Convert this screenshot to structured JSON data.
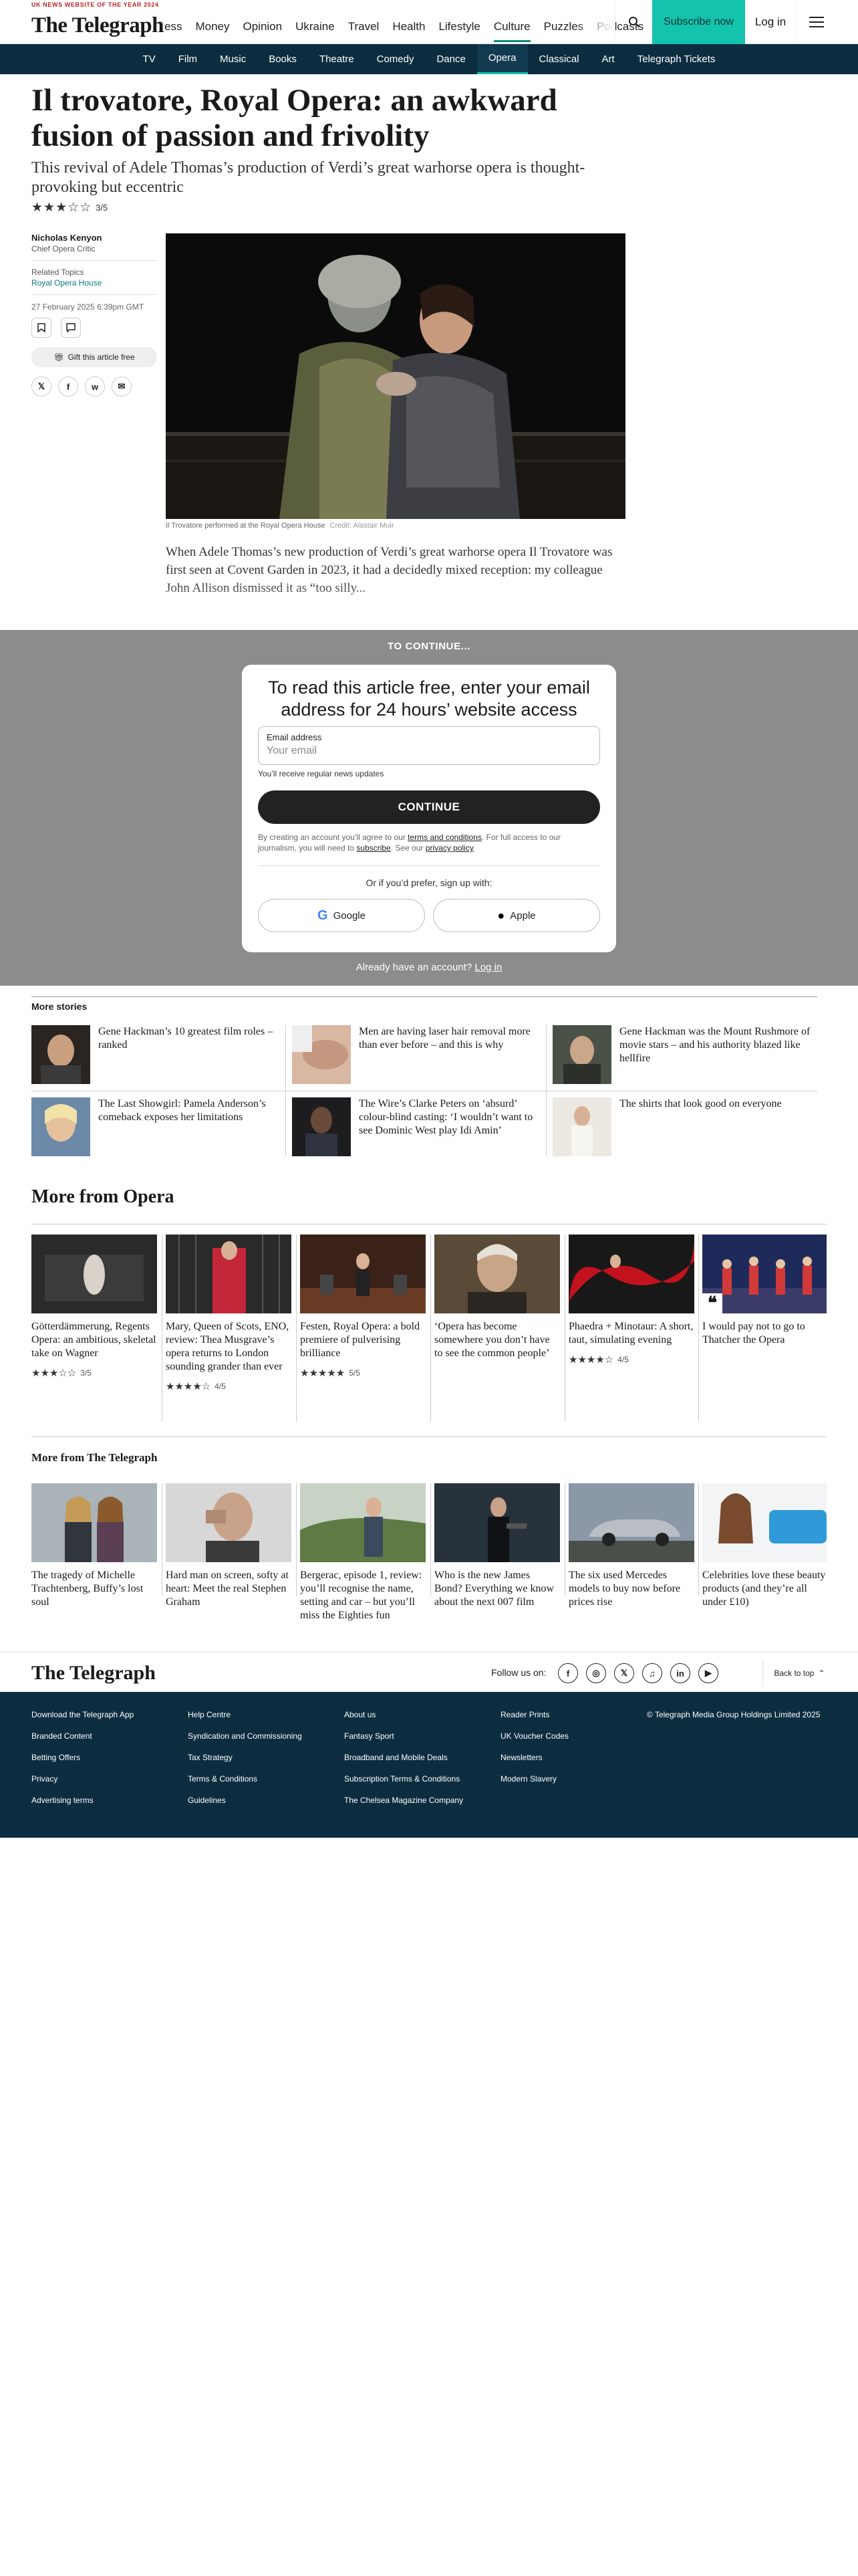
{
  "header": {
    "award": "UK NEWS WEBSITE OF THE YEAR 2024",
    "logo": "The Telegraph",
    "nav": [
      "ess",
      "Money",
      "Opinion",
      "Ukraine",
      "Travel",
      "Health",
      "Lifestyle",
      "Culture",
      "Puzzles",
      "Podcasts"
    ],
    "subscribe": "Subscribe now",
    "login": "Log in"
  },
  "subnav": [
    "TV",
    "Film",
    "Music",
    "Books",
    "Theatre",
    "Comedy",
    "Dance",
    "Opera",
    "Classical",
    "Art",
    "Telegraph Tickets"
  ],
  "article": {
    "headline": "Il trovatore, Royal Opera: an awkward fusion of passion and frivolity",
    "standfirst": "This revival of Adele Thomas’s production of Verdi’s great warhorse opera is thought-provoking but eccentric",
    "stars": "★★★☆☆",
    "rating": "3/5",
    "author": "Nicholas Kenyon",
    "role": "Chief Opera Critic",
    "related_label": "Related Topics",
    "related_topic": "Royal Opera House",
    "date": "27 February 2025 6:39pm GMT",
    "gift": "Gift this article free",
    "share": [
      "𝕏",
      "f",
      "w",
      "✉"
    ],
    "caption": "Il Trovatore performed at the Royal Opera House",
    "credit": "Credit: Alastair Muir",
    "body": "When Adele Thomas’s new production of Verdi’s great warhorse opera Il Trovatore was first seen at Covent Garden in 2023, it had a decidedly mixed reception: my colleague John Allison dismissed it as “too silly..."
  },
  "paywall": {
    "continue_banner": "TO CONTINUE...",
    "title": "To read this article free, enter your email address for 24 hours’ website access",
    "email_label": "Email address",
    "email_placeholder": "Your email",
    "note": "You’ll receive regular news updates",
    "button": "CONTINUE",
    "terms_1": "By creating an account you’ll agree to our",
    "terms_link": "terms and conditions",
    "terms_2": ". For full access to our journalism, you will need to",
    "subscribe_link": "subscribe",
    "terms_3": ". See our",
    "privacy_link": "privacy policy",
    "or": "Or if you’d prefer, sign up with:",
    "google": "Google",
    "apple": "Apple",
    "already": "Already have an account?",
    "login_link": "Log in"
  },
  "more_stories": {
    "title": "More stories",
    "items": [
      "Gene Hackman’s 10 greatest film roles – ranked",
      "Men are having laser hair removal more than ever before – and this is why",
      "Gene Hackman was the Mount Rushmore of movie stars – and his authority blazed like hellfire",
      "The Last Showgirl: Pamela Anderson’s comeback exposes her limitations",
      "The Wire’s Clarke Peters on ‘absurd’ colour-blind casting: ‘I wouldn’t want to see Dominic West play Idi Amin’",
      "The shirts that look good on everyone"
    ]
  },
  "more_opera": {
    "title": "More from Opera",
    "items": [
      {
        "title": "Götterdämmerung, Regents Opera: an ambitious, skeletal take on Wagner",
        "stars": "★★★☆☆",
        "rating": "3/5"
      },
      {
        "title": "Mary, Queen of Scots, ENO, review: Thea Musgrave’s opera returns to London sounding grander than ever",
        "stars": "★★★★☆",
        "rating": "4/5"
      },
      {
        "title": "Festen, Royal Opera: a bold premiere of pulverising brilliance",
        "stars": "★★★★★",
        "rating": "5/5"
      },
      {
        "title": "‘Opera has become somewhere you don’t have to see the common people’",
        "stars": "",
        "rating": ""
      },
      {
        "title": "Phaedra + Minotaur: A short, taut, simulating evening",
        "stars": "★★★★☆",
        "rating": "4/5"
      },
      {
        "title": "I would pay not to go to Thatcher the Opera",
        "stars": "",
        "rating": ""
      }
    ]
  },
  "more_telegraph": {
    "title": "More from The Telegraph",
    "items": [
      "The tragedy of Michelle Trachtenberg, Buffy’s lost soul",
      "Hard man on screen, softy at heart: Meet the real Stephen Graham",
      "Bergerac, episode 1, review: you’ll recognise the name, setting and car – but you’ll miss the Eighties fun",
      "Who is the new James Bond? Everything we know about the next 007 film",
      "The six used Mercedes models to buy now before prices rise",
      "Celebrities love these beauty products (and they’re all under £10)"
    ]
  },
  "footer": {
    "logo": "The Telegraph",
    "follow": "Follow us on:",
    "social": [
      "f",
      "◎",
      "𝕏",
      "♫",
      "in",
      "▶"
    ],
    "back": "Back to top",
    "col1": [
      "Download the Telegraph App",
      "Branded Content",
      "Betting Offers",
      "Privacy",
      "Advertising terms"
    ],
    "col2": [
      "Help Centre",
      "Syndication and Commissioning",
      "Tax Strategy",
      "Terms & Conditions",
      "Guidelines"
    ],
    "col3": [
      "About us",
      "Fantasy Sport",
      "Broadband and Mobile Deals",
      "Subscription Terms & Conditions",
      "The Chelsea Magazine Company"
    ],
    "col4": [
      "Reader Prints",
      "UK Voucher Codes",
      "Newsletters",
      "Modern Slavery"
    ],
    "copyright": "© Telegraph Media Group Holdings Limited 2025"
  },
  "colors": {
    "accent": "#14c3ad",
    "navy": "#0c2d3f",
    "paywall": "#8c8c8c"
  }
}
